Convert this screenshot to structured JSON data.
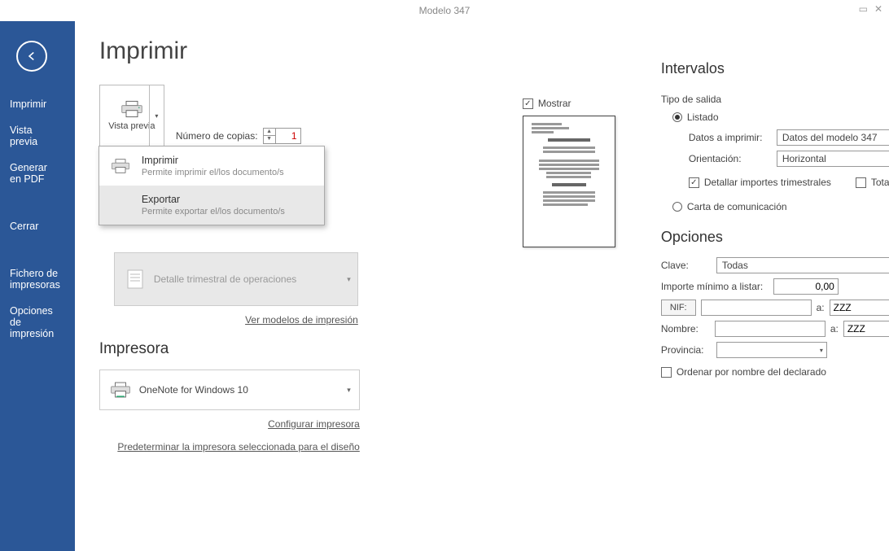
{
  "title": "Modelo 347",
  "sidebar": {
    "items": [
      "Imprimir",
      "Vista previa",
      "Generar en PDF",
      "Cerrar",
      "Fichero de impresoras",
      "Opciones de impresión"
    ]
  },
  "page": {
    "heading": "Imprimir",
    "vista_previa": "Vista previa",
    "copies_label": "Número de copias:",
    "copies_value": "1",
    "dropdown": {
      "imprimir_title": "Imprimir",
      "imprimir_sub": "Permite imprimir el/los documento/s",
      "exportar_title": "Exportar",
      "exportar_sub": "Permite exportar el/los documento/s"
    },
    "detalle_label": "Detalle trimestral de operaciones",
    "ver_modelos": "Ver modelos de impresión",
    "impresora_heading": "Impresora",
    "printer_name": "OneNote for Windows 10",
    "config_link": "Configurar impresora",
    "predet_link": "Predeterminar la impresora seleccionada para el diseño",
    "mostrar": "Mostrar"
  },
  "intervalos": {
    "heading": "Intervalos",
    "tipo_salida": "Tipo de salida",
    "listado": "Listado",
    "datos_imprimir": "Datos a imprimir:",
    "datos_value": "Datos del modelo 347",
    "orientacion": "Orientación:",
    "orientacion_value": "Horizontal",
    "detallar": "Detallar importes trimestrales",
    "totalizar": "Totalizar registros",
    "carta": "Carta de comunicación"
  },
  "opciones": {
    "heading": "Opciones",
    "clave": "Clave:",
    "clave_value": "Todas",
    "importe_label": "Importe mínimo a listar:",
    "importe_value": "0,00",
    "nif_btn": "NIF:",
    "a_label": "a:",
    "nif_to": "ZZZ",
    "nombre": "Nombre:",
    "nombre_to": "ZZZ",
    "provincia": "Provincia:",
    "ordenar": "Ordenar por nombre del declarado"
  }
}
